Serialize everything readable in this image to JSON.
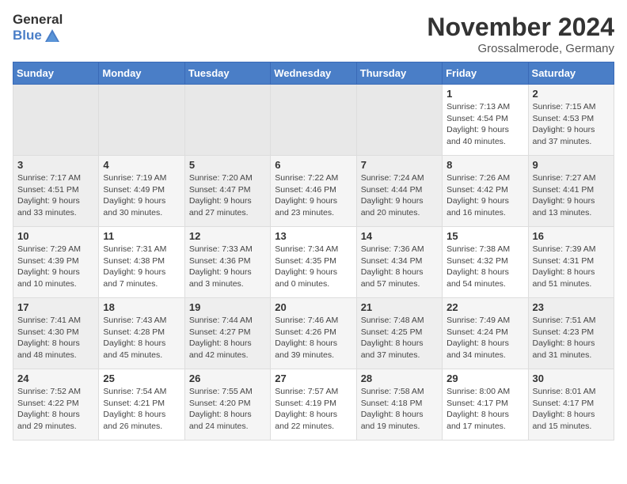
{
  "header": {
    "logo_general": "General",
    "logo_blue": "Blue",
    "month_title": "November 2024",
    "location": "Grossalmerode, Germany"
  },
  "days_of_week": [
    "Sunday",
    "Monday",
    "Tuesday",
    "Wednesday",
    "Thursday",
    "Friday",
    "Saturday"
  ],
  "weeks": [
    [
      {
        "day": "",
        "sunrise": "",
        "sunset": "",
        "daylight": "",
        "empty": true
      },
      {
        "day": "",
        "sunrise": "",
        "sunset": "",
        "daylight": "",
        "empty": true
      },
      {
        "day": "",
        "sunrise": "",
        "sunset": "",
        "daylight": "",
        "empty": true
      },
      {
        "day": "",
        "sunrise": "",
        "sunset": "",
        "daylight": "",
        "empty": true
      },
      {
        "day": "",
        "sunrise": "",
        "sunset": "",
        "daylight": "",
        "empty": true
      },
      {
        "day": "1",
        "sunrise": "Sunrise: 7:13 AM",
        "sunset": "Sunset: 4:54 PM",
        "daylight": "Daylight: 9 hours and 40 minutes.",
        "empty": false
      },
      {
        "day": "2",
        "sunrise": "Sunrise: 7:15 AM",
        "sunset": "Sunset: 4:53 PM",
        "daylight": "Daylight: 9 hours and 37 minutes.",
        "empty": false
      }
    ],
    [
      {
        "day": "3",
        "sunrise": "Sunrise: 7:17 AM",
        "sunset": "Sunset: 4:51 PM",
        "daylight": "Daylight: 9 hours and 33 minutes.",
        "empty": false
      },
      {
        "day": "4",
        "sunrise": "Sunrise: 7:19 AM",
        "sunset": "Sunset: 4:49 PM",
        "daylight": "Daylight: 9 hours and 30 minutes.",
        "empty": false
      },
      {
        "day": "5",
        "sunrise": "Sunrise: 7:20 AM",
        "sunset": "Sunset: 4:47 PM",
        "daylight": "Daylight: 9 hours and 27 minutes.",
        "empty": false
      },
      {
        "day": "6",
        "sunrise": "Sunrise: 7:22 AM",
        "sunset": "Sunset: 4:46 PM",
        "daylight": "Daylight: 9 hours and 23 minutes.",
        "empty": false
      },
      {
        "day": "7",
        "sunrise": "Sunrise: 7:24 AM",
        "sunset": "Sunset: 4:44 PM",
        "daylight": "Daylight: 9 hours and 20 minutes.",
        "empty": false
      },
      {
        "day": "8",
        "sunrise": "Sunrise: 7:26 AM",
        "sunset": "Sunset: 4:42 PM",
        "daylight": "Daylight: 9 hours and 16 minutes.",
        "empty": false
      },
      {
        "day": "9",
        "sunrise": "Sunrise: 7:27 AM",
        "sunset": "Sunset: 4:41 PM",
        "daylight": "Daylight: 9 hours and 13 minutes.",
        "empty": false
      }
    ],
    [
      {
        "day": "10",
        "sunrise": "Sunrise: 7:29 AM",
        "sunset": "Sunset: 4:39 PM",
        "daylight": "Daylight: 9 hours and 10 minutes.",
        "empty": false
      },
      {
        "day": "11",
        "sunrise": "Sunrise: 7:31 AM",
        "sunset": "Sunset: 4:38 PM",
        "daylight": "Daylight: 9 hours and 7 minutes.",
        "empty": false
      },
      {
        "day": "12",
        "sunrise": "Sunrise: 7:33 AM",
        "sunset": "Sunset: 4:36 PM",
        "daylight": "Daylight: 9 hours and 3 minutes.",
        "empty": false
      },
      {
        "day": "13",
        "sunrise": "Sunrise: 7:34 AM",
        "sunset": "Sunset: 4:35 PM",
        "daylight": "Daylight: 9 hours and 0 minutes.",
        "empty": false
      },
      {
        "day": "14",
        "sunrise": "Sunrise: 7:36 AM",
        "sunset": "Sunset: 4:34 PM",
        "daylight": "Daylight: 8 hours and 57 minutes.",
        "empty": false
      },
      {
        "day": "15",
        "sunrise": "Sunrise: 7:38 AM",
        "sunset": "Sunset: 4:32 PM",
        "daylight": "Daylight: 8 hours and 54 minutes.",
        "empty": false
      },
      {
        "day": "16",
        "sunrise": "Sunrise: 7:39 AM",
        "sunset": "Sunset: 4:31 PM",
        "daylight": "Daylight: 8 hours and 51 minutes.",
        "empty": false
      }
    ],
    [
      {
        "day": "17",
        "sunrise": "Sunrise: 7:41 AM",
        "sunset": "Sunset: 4:30 PM",
        "daylight": "Daylight: 8 hours and 48 minutes.",
        "empty": false
      },
      {
        "day": "18",
        "sunrise": "Sunrise: 7:43 AM",
        "sunset": "Sunset: 4:28 PM",
        "daylight": "Daylight: 8 hours and 45 minutes.",
        "empty": false
      },
      {
        "day": "19",
        "sunrise": "Sunrise: 7:44 AM",
        "sunset": "Sunset: 4:27 PM",
        "daylight": "Daylight: 8 hours and 42 minutes.",
        "empty": false
      },
      {
        "day": "20",
        "sunrise": "Sunrise: 7:46 AM",
        "sunset": "Sunset: 4:26 PM",
        "daylight": "Daylight: 8 hours and 39 minutes.",
        "empty": false
      },
      {
        "day": "21",
        "sunrise": "Sunrise: 7:48 AM",
        "sunset": "Sunset: 4:25 PM",
        "daylight": "Daylight: 8 hours and 37 minutes.",
        "empty": false
      },
      {
        "day": "22",
        "sunrise": "Sunrise: 7:49 AM",
        "sunset": "Sunset: 4:24 PM",
        "daylight": "Daylight: 8 hours and 34 minutes.",
        "empty": false
      },
      {
        "day": "23",
        "sunrise": "Sunrise: 7:51 AM",
        "sunset": "Sunset: 4:23 PM",
        "daylight": "Daylight: 8 hours and 31 minutes.",
        "empty": false
      }
    ],
    [
      {
        "day": "24",
        "sunrise": "Sunrise: 7:52 AM",
        "sunset": "Sunset: 4:22 PM",
        "daylight": "Daylight: 8 hours and 29 minutes.",
        "empty": false
      },
      {
        "day": "25",
        "sunrise": "Sunrise: 7:54 AM",
        "sunset": "Sunset: 4:21 PM",
        "daylight": "Daylight: 8 hours and 26 minutes.",
        "empty": false
      },
      {
        "day": "26",
        "sunrise": "Sunrise: 7:55 AM",
        "sunset": "Sunset: 4:20 PM",
        "daylight": "Daylight: 8 hours and 24 minutes.",
        "empty": false
      },
      {
        "day": "27",
        "sunrise": "Sunrise: 7:57 AM",
        "sunset": "Sunset: 4:19 PM",
        "daylight": "Daylight: 8 hours and 22 minutes.",
        "empty": false
      },
      {
        "day": "28",
        "sunrise": "Sunrise: 7:58 AM",
        "sunset": "Sunset: 4:18 PM",
        "daylight": "Daylight: 8 hours and 19 minutes.",
        "empty": false
      },
      {
        "day": "29",
        "sunrise": "Sunrise: 8:00 AM",
        "sunset": "Sunset: 4:17 PM",
        "daylight": "Daylight: 8 hours and 17 minutes.",
        "empty": false
      },
      {
        "day": "30",
        "sunrise": "Sunrise: 8:01 AM",
        "sunset": "Sunset: 4:17 PM",
        "daylight": "Daylight: 8 hours and 15 minutes.",
        "empty": false
      }
    ]
  ]
}
